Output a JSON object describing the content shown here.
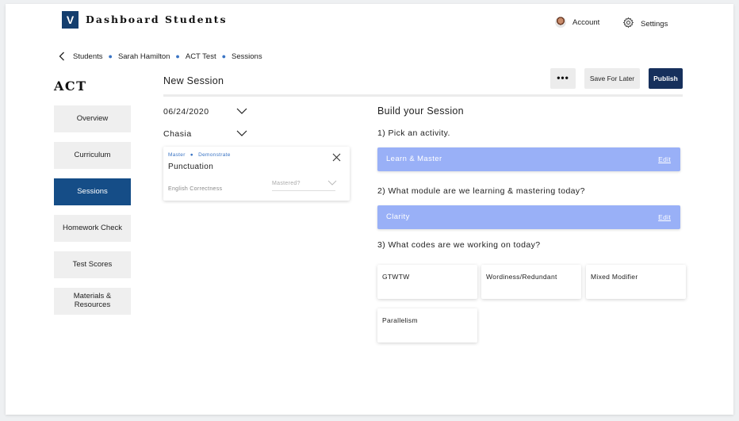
{
  "nav": {
    "logo": "V",
    "dashboard": "Dashboard",
    "students": "Students",
    "account": "Account",
    "settings": "Settings"
  },
  "breadcrumb": {
    "items": [
      "Students",
      "Sarah Hamilton",
      "ACT Test",
      "Sessions"
    ]
  },
  "sidebar": {
    "title": "ACT",
    "items": [
      {
        "label": "Overview"
      },
      {
        "label": "Curriculum"
      },
      {
        "label": "Sessions"
      },
      {
        "label": "Homework Check"
      },
      {
        "label": "Test Scores"
      },
      {
        "label": "Materials & Resources"
      }
    ],
    "active": "Sessions"
  },
  "header": {
    "title": "New Session",
    "more_label": "•••",
    "save_label": "Save For Later",
    "publish_label": "Publish"
  },
  "session": {
    "date": "06/24/2020",
    "tutor": "Chasia",
    "card": {
      "tag1": "Master",
      "tag2": "Demonstrate",
      "title": "Punctuation",
      "subject": "English Correctness",
      "status_placeholder": "Mastered?"
    }
  },
  "build": {
    "title": "Build your Session",
    "q1": "1) Pick an activity.",
    "activity": "Learn & Master",
    "q2": "2) What module are we learning & mastering today?",
    "module": "Clarity",
    "edit_label": "Edit",
    "q3": "3) What codes are we working on today?",
    "codes": [
      "GTWTW",
      "Wordiness/Redundant",
      "Mixed Modifier",
      "Parallelism"
    ]
  },
  "colors": {
    "brand": "#143e6e",
    "active_nav": "#154d87",
    "publish": "#16305c",
    "accent_bar": "#99b0f7",
    "link_blue": "#3a74c4"
  }
}
